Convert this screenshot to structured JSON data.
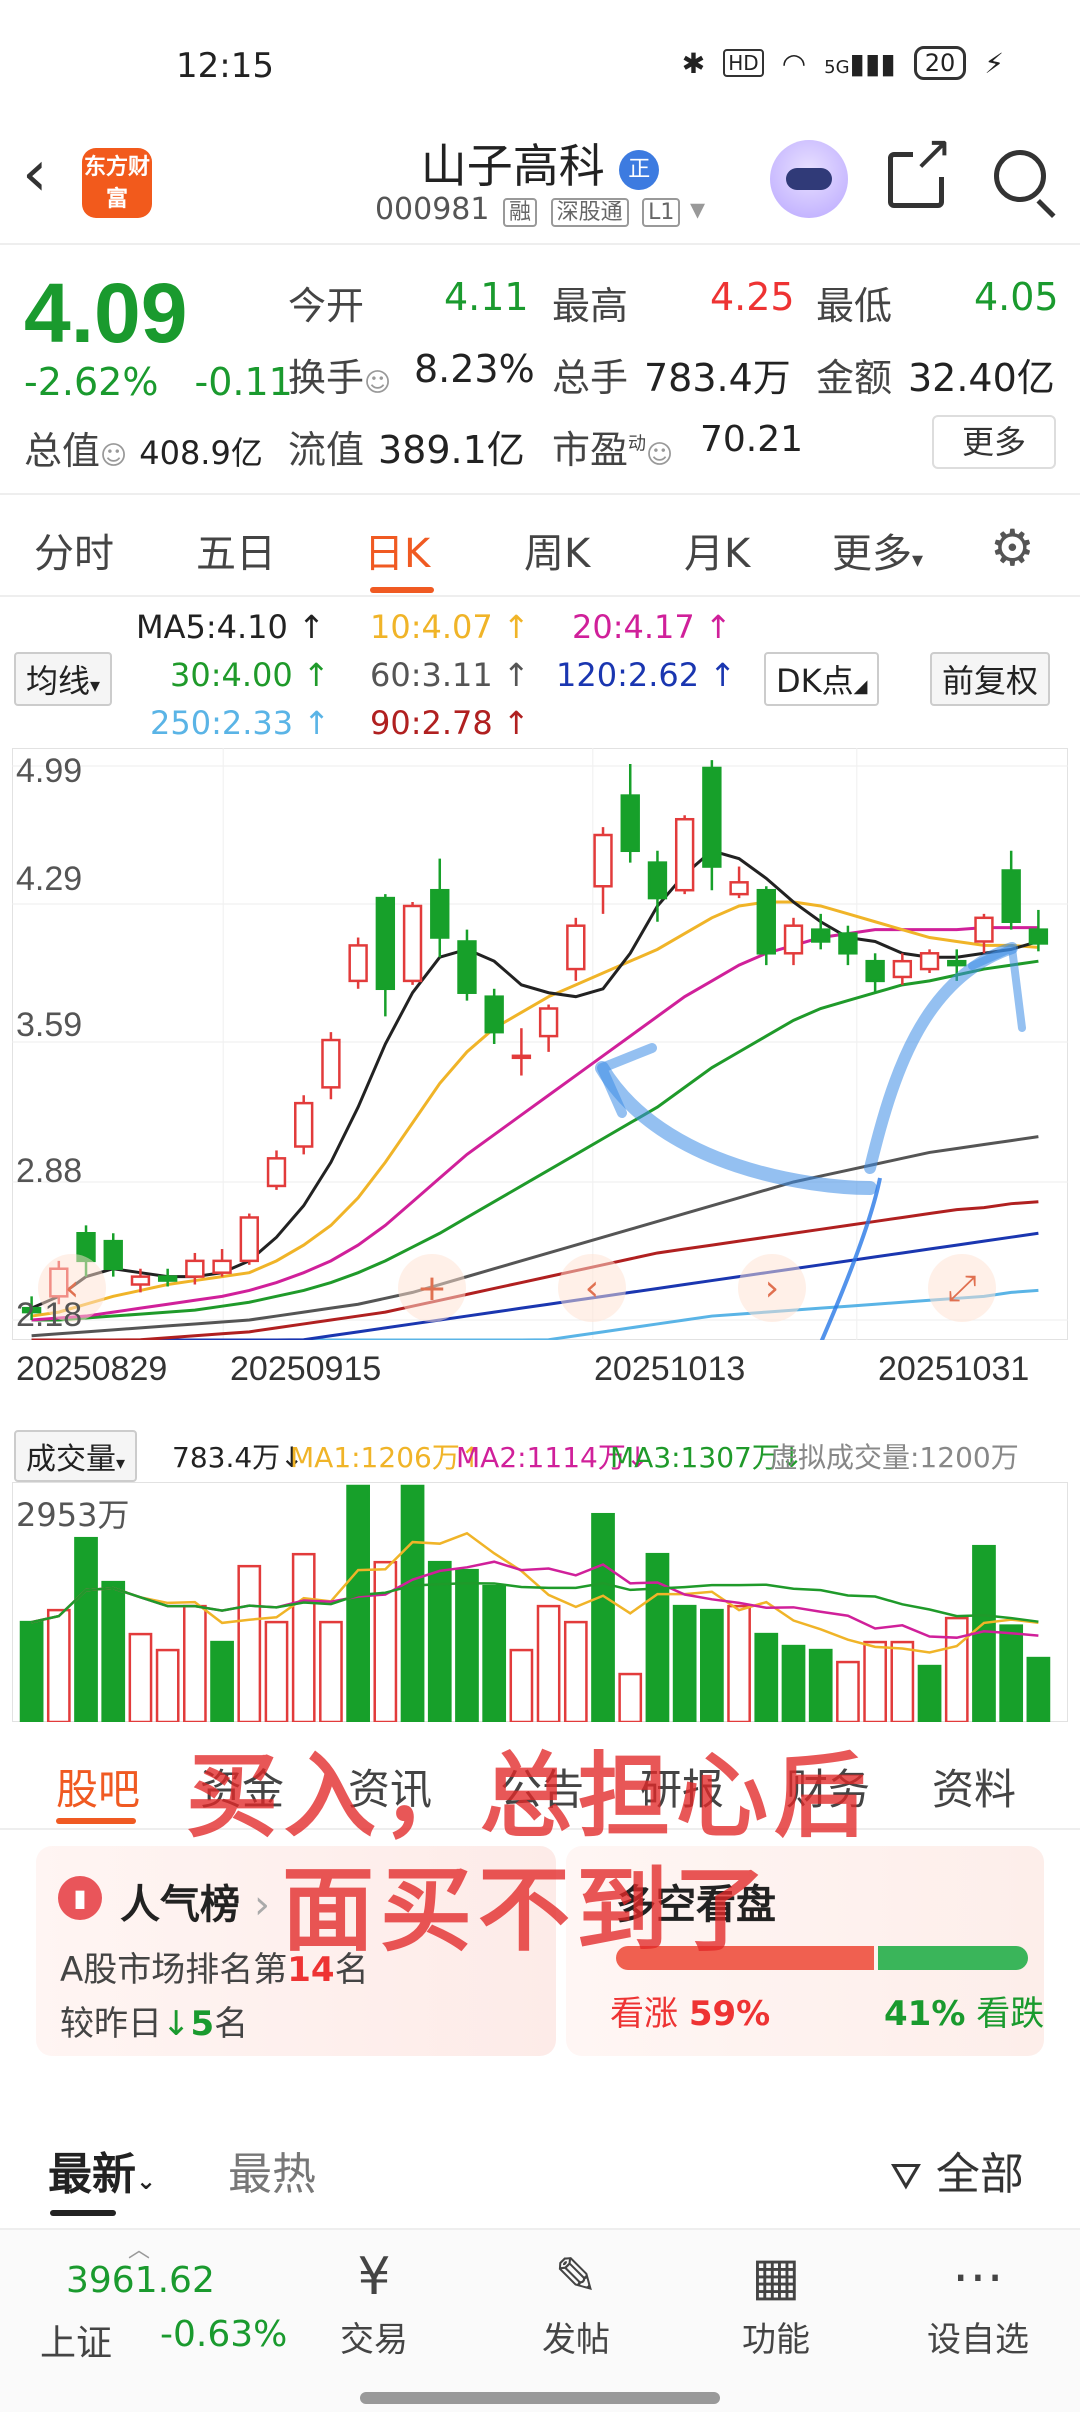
{
  "status_bar": {
    "time": "12:15",
    "battery": "20",
    "hd": "HD",
    "network": "5G"
  },
  "header": {
    "logo_text": "东方财富",
    "stock_name": "山子高科",
    "name_badge": "正",
    "stock_code": "000981",
    "tags": [
      "融",
      "深股通",
      "L1"
    ]
  },
  "quote": {
    "price": "4.09",
    "change_pct": "-2.62%",
    "change_abs": "-0.11",
    "total_cap_label": "总值",
    "total_cap": "408.9亿",
    "open_label": "今开",
    "open": "4.11",
    "high_label": "最高",
    "high": "4.25",
    "low_label": "最低",
    "low": "4.05",
    "turnover_label": "换手",
    "turnover": "8.23%",
    "volume_label": "总手",
    "volume": "783.4万",
    "amount_label": "金额",
    "amount": "32.40亿",
    "float_cap_label": "流值",
    "float_cap": "389.1亿",
    "pe_label": "市盈",
    "pe_sup": "动",
    "pe": "70.21",
    "more_button": "更多"
  },
  "period_tabs": [
    "分时",
    "五日",
    "日K",
    "周K",
    "月K",
    "更多"
  ],
  "active_period": "日K",
  "ma_legend": {
    "select_label": "均线",
    "ma5": "MA5:4.10",
    "ma10": "10:4.07",
    "ma20": "20:4.17",
    "ma30": "30:4.00",
    "ma60": "60:3.11",
    "ma120": "120:2.62",
    "ma250": "250:2.33",
    "ma90": "90:2.78",
    "dk_button": "DK点",
    "adjust_button": "前复权",
    "colors": {
      "ma5": "#222222",
      "ma10": "#f0b428",
      "ma20": "#d0209a",
      "ma30": "#1f9a2a",
      "ma60": "#555555",
      "ma120": "#1a36b0",
      "ma250": "#5ab4e6",
      "ma90": "#b02020"
    }
  },
  "chart_data": {
    "type": "candlestick",
    "y_ticks": [
      "4.99",
      "4.29",
      "3.59",
      "2.88",
      "2.18"
    ],
    "x_ticks": [
      "20250829",
      "20250915",
      "20251013",
      "20251031"
    ],
    "ylim": [
      2.18,
      4.99
    ],
    "candles": [
      {
        "o": 2.24,
        "c": 2.22,
        "h": 2.3,
        "l": 2.18,
        "up": false
      },
      {
        "o": 2.3,
        "c": 2.44,
        "h": 2.48,
        "l": 2.26,
        "up": true
      },
      {
        "o": 2.62,
        "c": 2.48,
        "h": 2.66,
        "l": 2.4,
        "up": false
      },
      {
        "o": 2.58,
        "c": 2.44,
        "h": 2.62,
        "l": 2.4,
        "up": false
      },
      {
        "o": 2.36,
        "c": 2.4,
        "h": 2.44,
        "l": 2.32,
        "up": true
      },
      {
        "o": 2.4,
        "c": 2.38,
        "h": 2.44,
        "l": 2.35,
        "up": false
      },
      {
        "o": 2.4,
        "c": 2.48,
        "h": 2.52,
        "l": 2.36,
        "up": true
      },
      {
        "o": 2.42,
        "c": 2.48,
        "h": 2.54,
        "l": 2.4,
        "up": true
      },
      {
        "o": 2.48,
        "c": 2.7,
        "h": 2.72,
        "l": 2.46,
        "up": true
      },
      {
        "o": 2.86,
        "c": 3.0,
        "h": 3.04,
        "l": 2.84,
        "up": true
      },
      {
        "o": 3.06,
        "c": 3.28,
        "h": 3.32,
        "l": 3.02,
        "up": true
      },
      {
        "o": 3.36,
        "c": 3.6,
        "h": 3.64,
        "l": 3.3,
        "up": true
      },
      {
        "o": 3.9,
        "c": 4.08,
        "h": 4.12,
        "l": 3.86,
        "up": true
      },
      {
        "o": 4.32,
        "c": 3.86,
        "h": 4.34,
        "l": 3.72,
        "up": false
      },
      {
        "o": 3.9,
        "c": 4.28,
        "h": 4.3,
        "l": 3.88,
        "up": true
      },
      {
        "o": 4.36,
        "c": 4.12,
        "h": 4.52,
        "l": 4.02,
        "up": false
      },
      {
        "o": 4.1,
        "c": 3.84,
        "h": 4.16,
        "l": 3.8,
        "up": false
      },
      {
        "o": 3.82,
        "c": 3.64,
        "h": 3.86,
        "l": 3.58,
        "up": false
      },
      {
        "o": 3.52,
        "c": 3.52,
        "h": 3.66,
        "l": 3.42,
        "up": true
      },
      {
        "o": 3.62,
        "c": 3.76,
        "h": 3.78,
        "l": 3.54,
        "up": true
      },
      {
        "o": 3.96,
        "c": 4.18,
        "h": 4.22,
        "l": 3.9,
        "up": true
      },
      {
        "o": 4.38,
        "c": 4.64,
        "h": 4.68,
        "l": 4.24,
        "up": true
      },
      {
        "o": 4.84,
        "c": 4.56,
        "h": 5.0,
        "l": 4.5,
        "up": false
      },
      {
        "o": 4.5,
        "c": 4.32,
        "h": 4.56,
        "l": 4.2,
        "up": false
      },
      {
        "o": 4.36,
        "c": 4.72,
        "h": 4.74,
        "l": 4.34,
        "up": true
      },
      {
        "o": 4.98,
        "c": 4.48,
        "h": 5.02,
        "l": 4.36,
        "up": false
      },
      {
        "o": 4.34,
        "c": 4.4,
        "h": 4.48,
        "l": 4.32,
        "up": true
      },
      {
        "o": 4.36,
        "c": 4.04,
        "h": 4.38,
        "l": 3.98,
        "up": false
      },
      {
        "o": 4.04,
        "c": 4.18,
        "h": 4.22,
        "l": 3.98,
        "up": true
      },
      {
        "o": 4.16,
        "c": 4.1,
        "h": 4.24,
        "l": 4.06,
        "up": false
      },
      {
        "o": 4.14,
        "c": 4.04,
        "h": 4.18,
        "l": 3.98,
        "up": false
      },
      {
        "o": 4.0,
        "c": 3.9,
        "h": 4.04,
        "l": 3.84,
        "up": false
      },
      {
        "o": 3.92,
        "c": 4.0,
        "h": 4.04,
        "l": 3.88,
        "up": true
      },
      {
        "o": 3.96,
        "c": 4.04,
        "h": 4.06,
        "l": 3.94,
        "up": true
      },
      {
        "o": 4.0,
        "c": 3.98,
        "h": 4.06,
        "l": 3.9,
        "up": false
      },
      {
        "o": 4.1,
        "c": 4.22,
        "h": 4.24,
        "l": 4.04,
        "up": true
      },
      {
        "o": 4.46,
        "c": 4.2,
        "h": 4.56,
        "l": 4.16,
        "up": false
      },
      {
        "o": 4.16,
        "c": 4.09,
        "h": 4.26,
        "l": 4.05,
        "up": false
      }
    ],
    "ma5": [
      2.24,
      2.3,
      2.4,
      2.44,
      2.42,
      2.4,
      2.4,
      2.42,
      2.48,
      2.6,
      2.76,
      2.98,
      3.26,
      3.58,
      3.84,
      4.02,
      4.06,
      4.0,
      3.88,
      3.84,
      3.82,
      3.86,
      4.04,
      4.28,
      4.44,
      4.56,
      4.52,
      4.42,
      4.3,
      4.2,
      4.12,
      4.1,
      4.04,
      4.02,
      4.02,
      4.04,
      4.06,
      4.1
    ],
    "ma10": [
      2.2,
      2.22,
      2.26,
      2.3,
      2.33,
      2.36,
      2.38,
      2.4,
      2.42,
      2.48,
      2.56,
      2.66,
      2.8,
      2.98,
      3.18,
      3.38,
      3.54,
      3.66,
      3.74,
      3.82,
      3.88,
      3.94,
      4.0,
      4.06,
      4.14,
      4.22,
      4.28,
      4.3,
      4.3,
      4.28,
      4.24,
      4.2,
      4.16,
      4.12,
      4.1,
      4.08,
      4.08,
      4.07
    ],
    "ma20": [
      2.18,
      2.19,
      2.2,
      2.22,
      2.24,
      2.26,
      2.28,
      2.3,
      2.33,
      2.37,
      2.42,
      2.48,
      2.56,
      2.66,
      2.78,
      2.9,
      3.02,
      3.12,
      3.22,
      3.32,
      3.42,
      3.52,
      3.62,
      3.72,
      3.82,
      3.9,
      3.98,
      4.04,
      4.08,
      4.12,
      4.14,
      4.16,
      4.16,
      4.16,
      4.16,
      4.17,
      4.17,
      4.17
    ],
    "ma30": [
      2.18,
      2.18,
      2.19,
      2.2,
      2.21,
      2.22,
      2.23,
      2.25,
      2.27,
      2.3,
      2.33,
      2.37,
      2.42,
      2.48,
      2.55,
      2.62,
      2.7,
      2.78,
      2.86,
      2.94,
      3.02,
      3.1,
      3.18,
      3.26,
      3.36,
      3.46,
      3.54,
      3.62,
      3.7,
      3.76,
      3.8,
      3.84,
      3.88,
      3.9,
      3.93,
      3.96,
      3.98,
      4.0
    ],
    "ma60": [
      2.1,
      2.11,
      2.12,
      2.13,
      2.14,
      2.15,
      2.16,
      2.17,
      2.18,
      2.2,
      2.22,
      2.24,
      2.26,
      2.29,
      2.32,
      2.36,
      2.4,
      2.44,
      2.48,
      2.52,
      2.56,
      2.6,
      2.64,
      2.68,
      2.72,
      2.76,
      2.8,
      2.84,
      2.88,
      2.91,
      2.94,
      2.97,
      3.0,
      3.03,
      3.05,
      3.07,
      3.09,
      3.11
    ],
    "ma90": [
      2.04,
      2.05,
      2.06,
      2.07,
      2.08,
      2.09,
      2.1,
      2.11,
      2.12,
      2.14,
      2.16,
      2.18,
      2.2,
      2.22,
      2.25,
      2.28,
      2.31,
      2.34,
      2.37,
      2.4,
      2.43,
      2.46,
      2.49,
      2.52,
      2.54,
      2.56,
      2.58,
      2.6,
      2.62,
      2.64,
      2.66,
      2.68,
      2.7,
      2.72,
      2.74,
      2.75,
      2.77,
      2.78
    ],
    "ma120": [
      1.98,
      1.99,
      2.0,
      2.01,
      2.02,
      2.03,
      2.04,
      2.05,
      2.06,
      2.07,
      2.08,
      2.1,
      2.12,
      2.14,
      2.16,
      2.18,
      2.2,
      2.22,
      2.24,
      2.26,
      2.28,
      2.3,
      2.32,
      2.34,
      2.36,
      2.38,
      2.4,
      2.42,
      2.44,
      2.46,
      2.48,
      2.5,
      2.52,
      2.54,
      2.56,
      2.58,
      2.6,
      2.62
    ],
    "ma250": [
      1.8,
      1.81,
      1.82,
      1.83,
      1.84,
      1.85,
      1.86,
      1.87,
      1.88,
      1.89,
      1.9,
      1.92,
      1.94,
      1.96,
      1.98,
      2.0,
      2.02,
      2.04,
      2.06,
      2.08,
      2.1,
      2.12,
      2.14,
      2.16,
      2.18,
      2.2,
      2.21,
      2.22,
      2.23,
      2.24,
      2.25,
      2.26,
      2.27,
      2.28,
      2.29,
      2.3,
      2.32,
      2.33
    ]
  },
  "volume": {
    "select_label": "成交量",
    "total": "783.4万",
    "ma1": "MA1:1206万",
    "ma2": "MA2:1114万",
    "ma3": "MA3:1307万",
    "virtual": "虚拟成交量:1200万",
    "max_label": "2953万",
    "bars": [
      {
        "v": 1250,
        "up": false
      },
      {
        "v": 1400,
        "up": true
      },
      {
        "v": 2300,
        "up": false
      },
      {
        "v": 1750,
        "up": false
      },
      {
        "v": 1100,
        "up": true
      },
      {
        "v": 900,
        "up": true
      },
      {
        "v": 1450,
        "up": true
      },
      {
        "v": 1000,
        "up": false
      },
      {
        "v": 1950,
        "up": true
      },
      {
        "v": 1250,
        "up": true
      },
      {
        "v": 2100,
        "up": true
      },
      {
        "v": 1250,
        "up": true
      },
      {
        "v": 2953,
        "up": false
      },
      {
        "v": 2000,
        "up": true
      },
      {
        "v": 2953,
        "up": false
      },
      {
        "v": 2000,
        "up": false
      },
      {
        "v": 1900,
        "up": false
      },
      {
        "v": 1700,
        "up": false
      },
      {
        "v": 900,
        "up": true
      },
      {
        "v": 1450,
        "up": true
      },
      {
        "v": 1250,
        "up": true
      },
      {
        "v": 2600,
        "up": false
      },
      {
        "v": 600,
        "up": true
      },
      {
        "v": 2100,
        "up": false
      },
      {
        "v": 1450,
        "up": false
      },
      {
        "v": 1400,
        "up": false
      },
      {
        "v": 1450,
        "up": true
      },
      {
        "v": 1100,
        "up": false
      },
      {
        "v": 950,
        "up": false
      },
      {
        "v": 900,
        "up": false
      },
      {
        "v": 750,
        "up": true
      },
      {
        "v": 1000,
        "up": true
      },
      {
        "v": 1000,
        "up": true
      },
      {
        "v": 700,
        "up": false
      },
      {
        "v": 1300,
        "up": true
      },
      {
        "v": 2200,
        "up": false
      },
      {
        "v": 1206,
        "up": false
      },
      {
        "v": 800,
        "up": false
      }
    ]
  },
  "overlay": {
    "line1": "买入，总担心后",
    "line2": "面买不到了"
  },
  "sub_tabs": [
    "股吧",
    "资金",
    "资讯",
    "公告",
    "研报",
    "财务",
    "资料"
  ],
  "cards": {
    "rank_title": "人气榜",
    "rank_line1_prefix": "A股市场排名第",
    "rank_value": "14",
    "rank_line1_suffix": "名",
    "rank_line2_prefix": "较昨日",
    "rank_change": "5",
    "rank_line2_suffix": "名",
    "sentiment_title": "多空看盘",
    "up_label": "看涨",
    "up_pct": "59%",
    "down_pct": "41%",
    "down_label": "看跌"
  },
  "sort_tabs": {
    "latest": "最新",
    "hot": "最热",
    "filter": "全部"
  },
  "bottom_bar": {
    "index_value": "3961.62",
    "index_name": "上证",
    "index_change": "-0.63%",
    "items": [
      {
        "label": "交易",
        "icon": "trade-icon"
      },
      {
        "label": "发帖",
        "icon": "post-icon"
      },
      {
        "label": "功能",
        "icon": "grid-icon"
      },
      {
        "label": "设自选",
        "icon": "more-icon"
      }
    ]
  }
}
